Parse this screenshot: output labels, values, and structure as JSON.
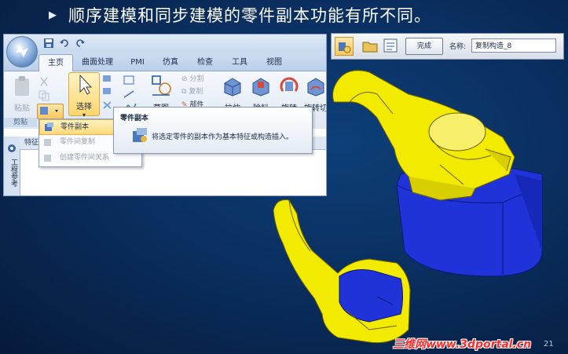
{
  "slide": {
    "title": "顺序建模和同步建模的零件副本功能有所不同。",
    "page_number": "21",
    "watermark": "三维网www.3dportal.cn"
  },
  "ribbon": {
    "tabs": [
      "主页",
      "曲面处理",
      "PMI",
      "仿真",
      "检查",
      "工具",
      "视图"
    ],
    "active_tab": "主页",
    "buttons": {
      "paste": "粘贴",
      "select": "选择",
      "sketch": "草图",
      "split": "分割",
      "duplicate": "复制",
      "part": "部件",
      "extrude": "拉伸",
      "cut": "除料",
      "revolve": "旋转",
      "revolve_cut": "旋转切"
    },
    "groups": {
      "clipboard": "剪贴",
      "sketch": "草图"
    },
    "feature_tab": "特征"
  },
  "left_panel": {
    "vertical_tab": "工程参考"
  },
  "dropdown_menu": {
    "items": [
      {
        "label": "零件副本",
        "enabled": true,
        "highlighted": true
      },
      {
        "label": "零件间复制",
        "enabled": false,
        "highlighted": false
      },
      {
        "label": "创建零件间关系",
        "enabled": false,
        "highlighted": false
      }
    ]
  },
  "tooltip": {
    "title": "零件副本",
    "description": "将选定零件的副本作为基本特征或构造插入。"
  },
  "mini_toolbar": {
    "done_button": "完成",
    "name_label": "名称:",
    "name_value": "复制构造_8"
  },
  "colors": {
    "background": "#0a2f60",
    "yellow_part": "#f2ea00",
    "blue_part": "#1a2fd6",
    "watermark": "#ff2a2a",
    "highlight": "#ffd66e"
  }
}
